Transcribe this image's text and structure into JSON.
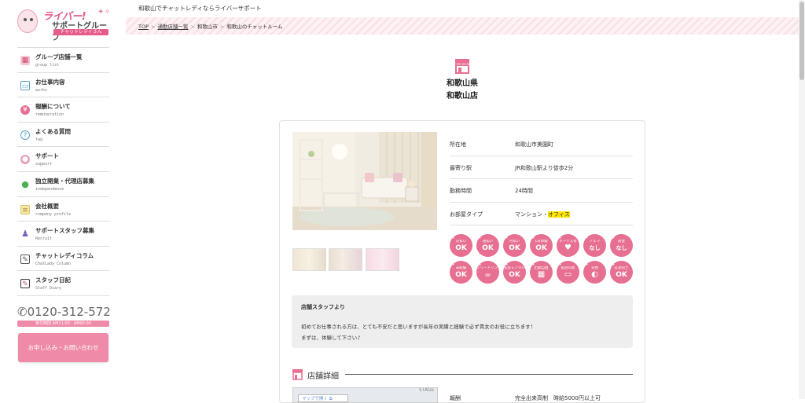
{
  "logo": {
    "line1": "ライバー!",
    "line2": "サポートグループ",
    "line3": "チャットレディさん"
  },
  "tagline": "和歌山でチャットレディならライバーサポート",
  "breadcrumb": [
    "TOP",
    "通勤店舗一覧",
    "和歌山市",
    "和歌山のチャットルーム"
  ],
  "sidebar": {
    "items": [
      {
        "jp": "グループ店舗一覧",
        "en": "group list",
        "icon": "shop-icon"
      },
      {
        "jp": "お仕事内容",
        "en": "works",
        "icon": "monitor-icon"
      },
      {
        "jp": "報酬について",
        "en": "remuneration",
        "icon": "wallet-icon"
      },
      {
        "jp": "よくある質問",
        "en": "faq",
        "icon": "question-icon"
      },
      {
        "jp": "サポート",
        "en": "support",
        "icon": "support-icon"
      },
      {
        "jp": "独立開業・代理店募集",
        "en": "independence",
        "icon": "person-icon"
      },
      {
        "jp": "会社概要",
        "en": "company profile",
        "icon": "document-icon"
      },
      {
        "jp": "サポートスタッフ募集",
        "en": "Recruit",
        "icon": "staff-icon"
      },
      {
        "jp": "チャットレディコラム",
        "en": "ChatLady Column",
        "icon": "pen-icon"
      },
      {
        "jp": "スタッフ日記",
        "en": "Staff Diary",
        "icon": "notebook-icon"
      }
    ],
    "phone": "0120-312-572",
    "hours": "受付時間 AM11:00 - AM05:00",
    "contact_button": "お申し込み・お問い合わせ"
  },
  "shop": {
    "prefecture": "和歌山県",
    "name": "和歌山店",
    "info": [
      {
        "key": "所在地",
        "value": "和歌山市美園町"
      },
      {
        "key": "最寄り駅",
        "value": "JR和歌山駅より徒歩2分"
      },
      {
        "key": "勤務時間",
        "value": "24時間"
      },
      {
        "key": "お部屋タイプ",
        "value_plain": "マンション・",
        "value_highlight": "オフィス"
      }
    ],
    "badges_row1": [
      {
        "top": "日払い",
        "main": "OK"
      },
      {
        "top": "週払い",
        "main": "OK"
      },
      {
        "top": "月払い",
        "main": "OK"
      },
      {
        "top": "1日体験",
        "main": "OK"
      },
      {
        "top": "ボーナス有",
        "main": "♥"
      },
      {
        "top": "ノルマ",
        "main": "なし"
      },
      {
        "top": "罰金",
        "main": "なし"
      }
    ],
    "badges_row2": [
      {
        "top": "未経験",
        "main": "OK"
      },
      {
        "top": "フリードリンク",
        "main": "☕"
      },
      {
        "top": "衣装レンタル",
        "main": "OK"
      },
      {
        "top": "出勤自由",
        "main": "▦"
      },
      {
        "top": "宿泊可能",
        "main": "▭"
      },
      {
        "top": "分煙",
        "main": "◐"
      },
      {
        "top": "友達同士",
        "main": "OK"
      }
    ],
    "staff_message": {
      "heading": "店舗スタッフより",
      "line1": "初めてお仕事される方は、とても不安だと思いますが長年の実績と経験で必ず貴女のお役に立ちます！",
      "line2": "まずは、体験して下さい♪"
    },
    "detail": {
      "heading": "店舗詳細",
      "map_button": "マップで開く ⧉",
      "map_label": "STAGE",
      "row_key": "報酬",
      "row_value": "完全出来高制　時給5000円以上可"
    }
  },
  "colors": {
    "accent": "#e76f91",
    "pink_button": "#ef8ba8"
  }
}
